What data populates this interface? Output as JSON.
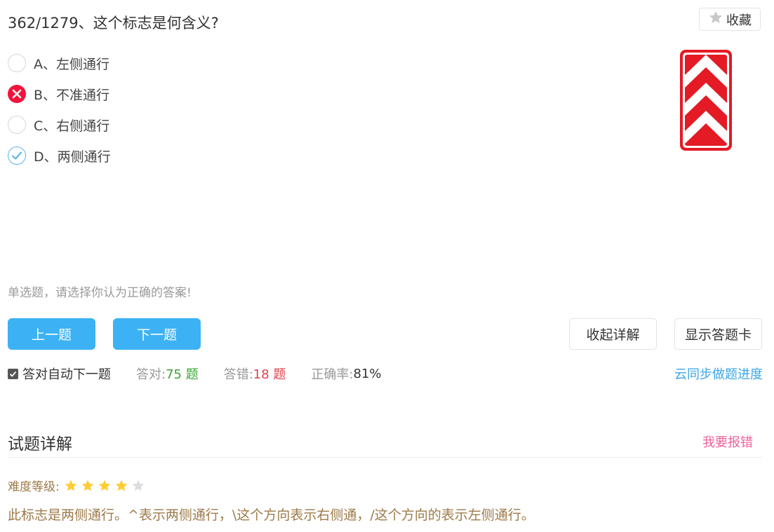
{
  "question": {
    "title": "362/1279、这个标志是何含义?"
  },
  "favorite": {
    "label": "收藏",
    "icon": "star-icon"
  },
  "options": [
    {
      "label": "A、左侧通行",
      "state": "unselected"
    },
    {
      "label": "B、不准通行",
      "state": "wrong"
    },
    {
      "label": "C、右侧通行",
      "state": "unselected"
    },
    {
      "label": "D、两侧通行",
      "state": "correct"
    }
  ],
  "sign": {
    "icon": "chevron-traffic-sign",
    "colors": {
      "red": "#e41a24",
      "white": "#ffffff"
    }
  },
  "hint": "单选题，请选择你认为正确的答案!",
  "buttons": {
    "prev": "上一题",
    "next": "下一题",
    "collapse": "收起详解",
    "show_card": "显示答题卡"
  },
  "stats": {
    "auto_next_label": "答对自动下一题",
    "auto_next_checked": true,
    "correct_label": "答对:",
    "correct_value": "75 题",
    "wrong_label": "答错:",
    "wrong_value": "18 题",
    "rate_label": "正确率:",
    "rate_value": "81%"
  },
  "sync_link": "云同步做题进度",
  "detail": {
    "title": "试题详解",
    "report_link": "我要报错",
    "difficulty_label": "难度等级:",
    "difficulty_stars": 4,
    "difficulty_max": 5,
    "explanation": "此标志是两侧通行。^表示两侧通行，\\这个方向表示右侧通，/这个方向的表示左侧通行。"
  },
  "colors": {
    "primary_blue": "#3cb2f4",
    "link_blue": "#3aa6e8",
    "wrong_red": "#f3133d",
    "correct_green": "#3aa534",
    "report_pink": "#f0609a",
    "explain_brown": "#9c7a48",
    "star_gold": "#ffcc33"
  }
}
